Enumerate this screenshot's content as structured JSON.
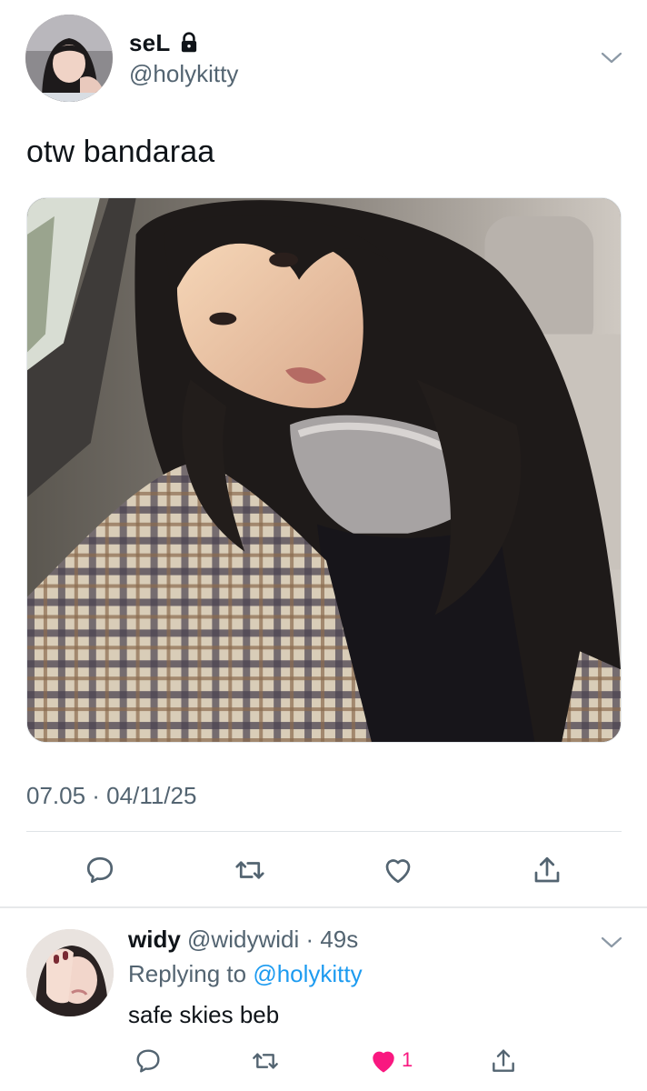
{
  "tweet": {
    "display_name": "seL",
    "handle": "@holykitty",
    "text": "otw bandaraa",
    "timestamp": "07.05 · 04/11/25",
    "protected": true
  },
  "reply": {
    "display_name": "widy",
    "meta": "@widywidi · 49s",
    "replying_prefix": "Replying to",
    "replying_to": "@holykitty",
    "text": "safe skies beb",
    "like_count": "1",
    "liked": true
  },
  "icons": {
    "lock": "lock-icon",
    "more": "chevron-down-icon",
    "reply": "reply-icon",
    "retweet": "retweet-icon",
    "like": "heart-icon",
    "share": "share-icon"
  },
  "colors": {
    "text_primary": "#0f1419",
    "text_secondary": "#536471",
    "link": "#1d9bf0",
    "like": "#f91880",
    "divider": "#dfe3e7"
  }
}
